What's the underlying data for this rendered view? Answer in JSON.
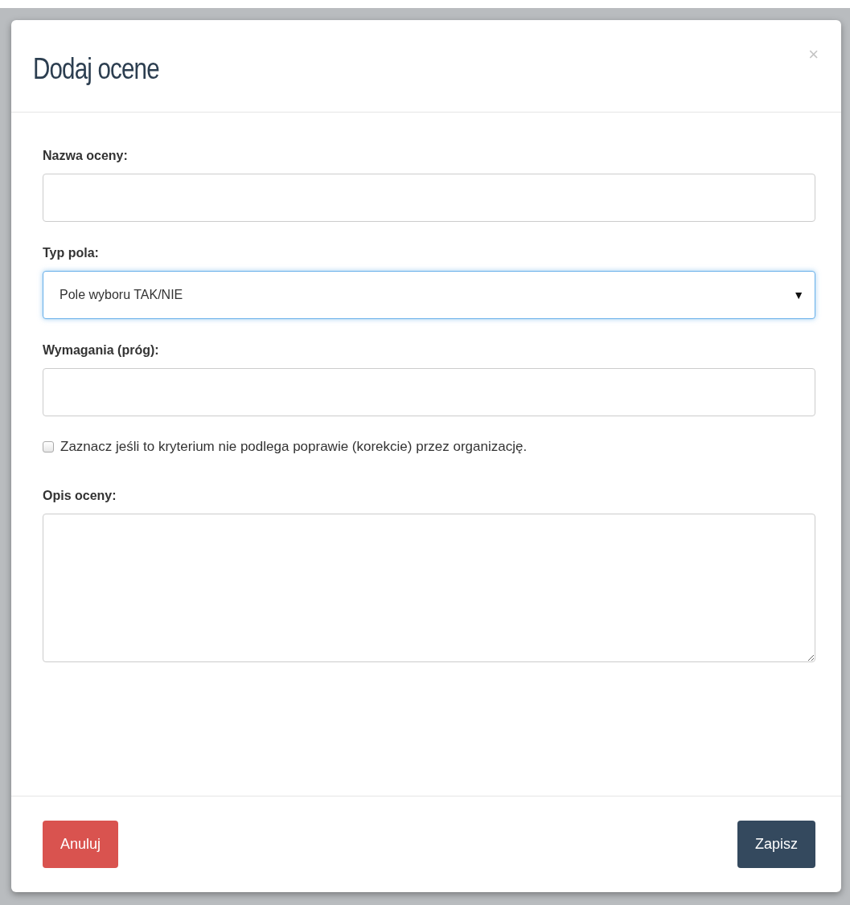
{
  "dialog": {
    "title": "Dodaj ocene",
    "close": "×",
    "fields": [
      {
        "kind": "text",
        "label": "Nazwa oceny:"
      },
      {
        "kind": "select",
        "label": "Typ pola:",
        "value": "Pole wyboru TAK/NIE",
        "arrow": "▼",
        "focused": true
      },
      {
        "kind": "text",
        "label": "Wymagania (próg):"
      },
      {
        "kind": "checkbox",
        "label": "Zaznacz jeśli to kryterium nie podlega poprawie (korekcie) przez organizację.",
        "checked": false
      },
      {
        "kind": "textarea",
        "label": "Opis oceny:"
      }
    ],
    "buttons": [
      {
        "kind": "cancel",
        "label": "Anuluj"
      },
      {
        "kind": "save",
        "label": "Zapisz"
      }
    ]
  }
}
